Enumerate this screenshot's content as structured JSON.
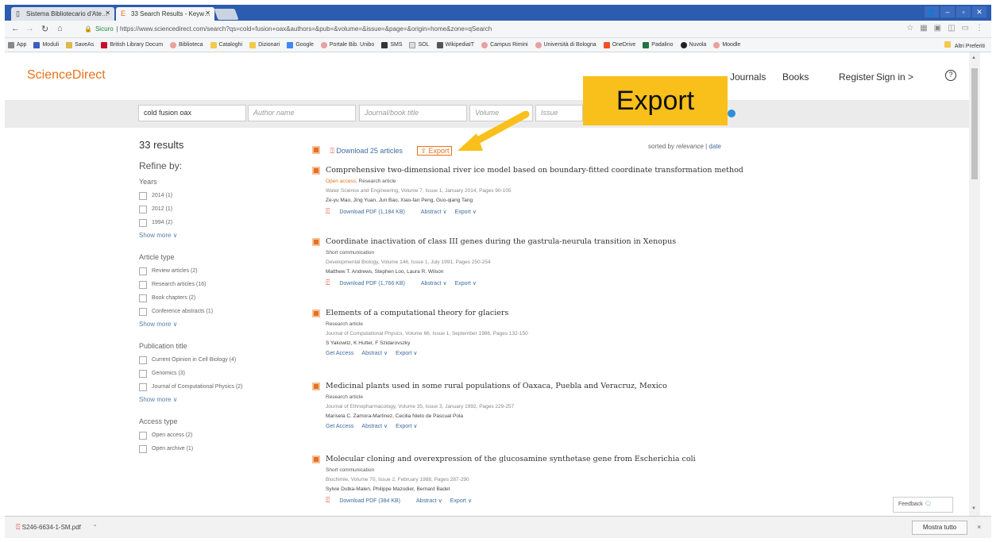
{
  "browser": {
    "tabs": [
      {
        "title": "Sistema Bibliotecario d'Ate…",
        "icon": "page-icon"
      },
      {
        "title": "33 Search Results - Keyw…",
        "icon": "elsevier-icon"
      }
    ],
    "url_secure": "Sicuro",
    "url": "https://www.sciencedirect.com/search?qs=cold+fusion+oax&authors=&pub=&volume=&issue=&page=&origin=home&zone=qSearch",
    "bookmarks": [
      "App",
      "Moduli",
      "SaveAs",
      "British Library Docum",
      "Biblioteca",
      "Cataloghi",
      "Dizionari",
      "Google",
      "Portale Bib. Unibo",
      "SMS",
      "SOL",
      "WikipediaIT",
      "Campus Rimini",
      "Università di Bologna",
      "OneDrive",
      "Padalino",
      "Nuvola",
      "Moodle"
    ],
    "other_bookmarks": "Altri Preferiti"
  },
  "header": {
    "logo": "ScienceDirect",
    "nav": [
      "Journals",
      "Books",
      "Register",
      "Sign in >"
    ],
    "help_icon": "?"
  },
  "search": {
    "query": "cold fusion oax",
    "author_placeholder": "Author name",
    "journal_placeholder": "Journal/book title",
    "volume_placeholder": "Volume",
    "issue_placeholder": "Issue"
  },
  "refine": {
    "results_count": "33 results",
    "title": "Refine by:",
    "show_more": "Show more ∨",
    "groups": [
      {
        "title": "Years",
        "items": [
          "2014 (1)",
          "2012 (1)",
          "1994 (2)"
        ],
        "show_more": true
      },
      {
        "title": "Article type",
        "items": [
          "Review articles (2)",
          "Research articles (16)",
          "Book chapters (2)",
          "Conference abstracts (1)"
        ],
        "show_more": true
      },
      {
        "title": "Publication title",
        "items": [
          "Current Opinion in Cell Biology (4)",
          "Genomics (3)",
          "Journal of Computational Physics (2)"
        ],
        "show_more": true
      },
      {
        "title": "Access type",
        "items": [
          "Open access (2)",
          "Open archive (1)"
        ],
        "show_more": false
      }
    ]
  },
  "toolbar": {
    "download": "Download 25 articles",
    "export": "Export",
    "sorted_prefix": "sorted by",
    "sorted_relevance": "relevance",
    "sorted_sep": "|",
    "sorted_date": "date"
  },
  "results": [
    {
      "title": "Comprehensive two-dimensional river ice model based on boundary-fitted coordinate transformation method",
      "open_access": "Open access",
      "type": ", Research article",
      "source": "Water Science and Engineering, Volume 7, Issue 1, January 2014, Pages 90-105",
      "authors": "Ze-yu Mao, Jing Yuan, Jun Bao, Xiao-fan Peng, Guo-qiang Tang",
      "links": [
        "Download PDF (1,184 KB)",
        "Abstract ∨",
        "Export ∨"
      ]
    },
    {
      "title": "Coordinate inactivation of class III genes during the gastrula-neurula transition in Xenopus",
      "open_access": "",
      "type": "Short communication",
      "source": "Developmental Biology, Volume 146, Issue 1, July 1991, Pages 250-254",
      "authors": "Matthew T. Andrews, Stephen Loo, Laura R. Wilson",
      "links": [
        "Download PDF (1,766 KB)",
        "Abstract ∨",
        "Export ∨"
      ]
    },
    {
      "title": "Elements of a computational theory for glaciers",
      "open_access": "",
      "type": "Research article",
      "source": "Journal of Computational Physics, Volume 66, Issue 1, September 1986, Pages 132-150",
      "authors": "S Yakowitz, K Hutter, F Szidarovszky",
      "links": [
        "Get Access",
        "Abstract ∨",
        "Export ∨"
      ]
    },
    {
      "title": "Medicinal plants used in some rural populations of Oaxaca, Puebla and Veracruz, Mexico",
      "open_access": "",
      "type": "Research article",
      "source": "Journal of Ethnopharmacology, Volume 35, Issue 3, January 1992, Pages 229-257",
      "authors": "Marisela C. Zamora-Martinez, Cecilia Nieto de Pascual Pola",
      "links": [
        "Get Access",
        "Abstract ∨",
        "Export ∨"
      ]
    },
    {
      "title": "Molecular cloning and overexpression of the glucosamine synthetase gene from Escherichia coli",
      "open_access": "",
      "type": "Short communication",
      "source": "Biochimie, Volume 70, Issue 2, February 1988, Pages 287-290",
      "authors": "Sylvie Dutka-Malen, Philippe Mazodier, Bernard Badet",
      "links": [
        "Download PDF (384 KB)",
        "Abstract ∨",
        "Export ∨"
      ]
    }
  ],
  "annotation": {
    "label": "Export",
    "color": "#f9c01b"
  },
  "feedback": "Feedback",
  "downloads": {
    "file": "S246-6634-1-SM.pdf",
    "show_all": "Mostra tutto",
    "close": "×"
  },
  "colors": {
    "brand": "#e9711c",
    "link": "#3e6c9f",
    "chrome": "#2b5cb0"
  }
}
